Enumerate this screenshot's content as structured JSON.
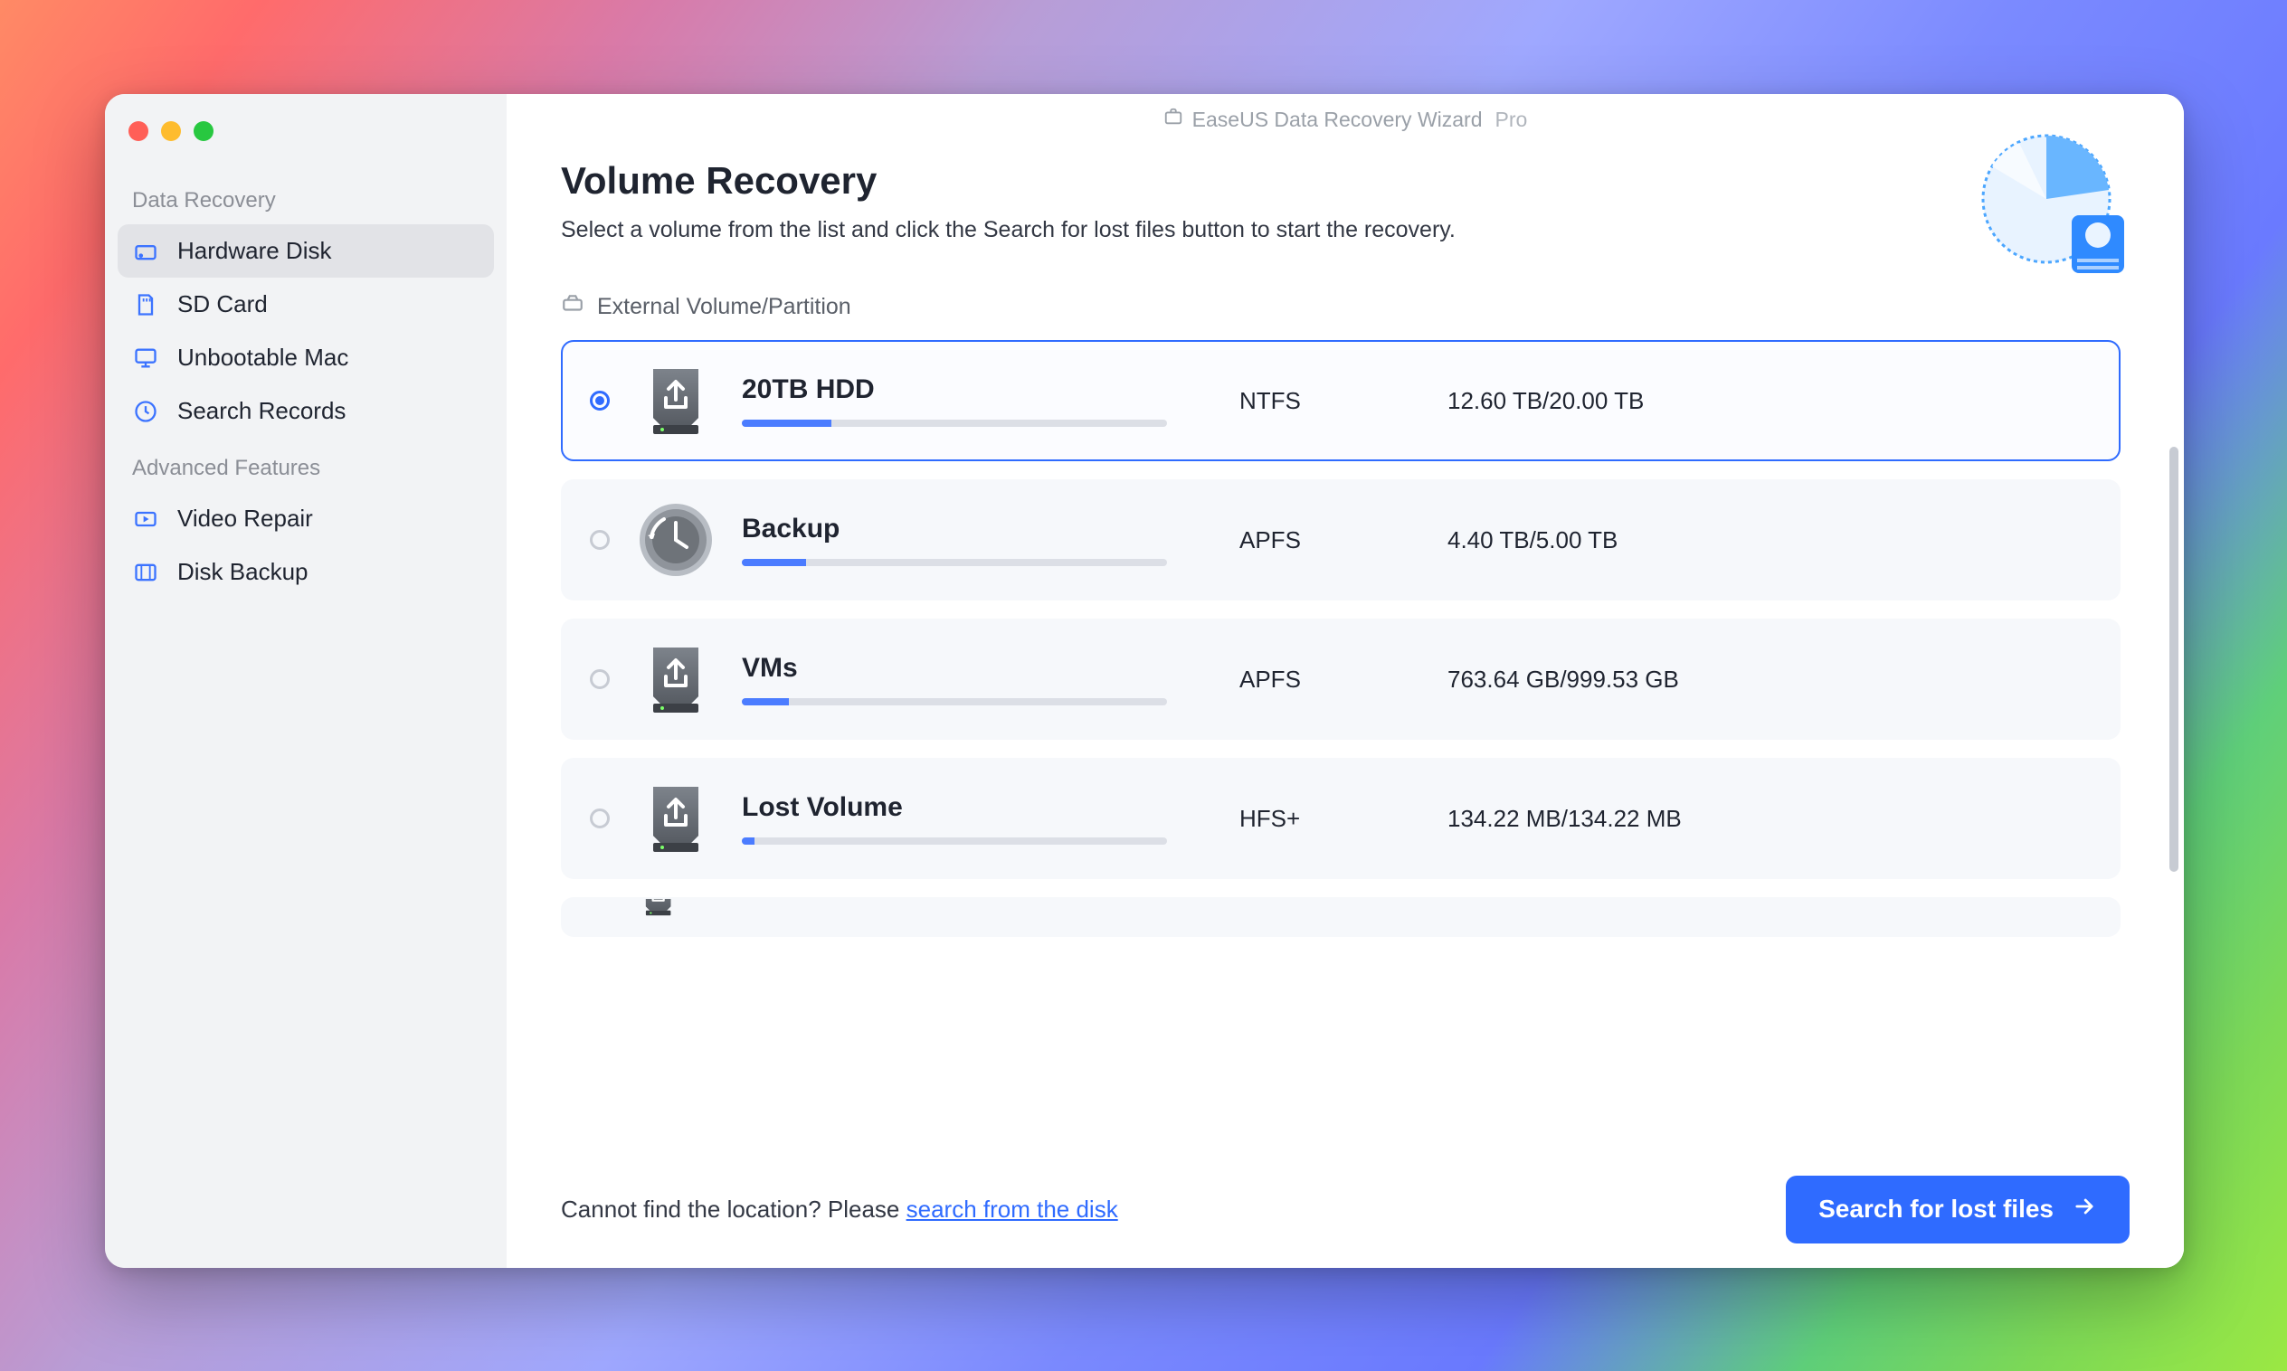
{
  "titlebar": {
    "app": "EaseUS Data Recovery Wizard",
    "edition": "Pro"
  },
  "sidebar": {
    "section1_label": "Data Recovery",
    "items1": [
      {
        "label": "Hardware Disk",
        "icon": "drive-icon",
        "active": true
      },
      {
        "label": "SD Card",
        "icon": "sd-card-icon",
        "active": false
      },
      {
        "label": "Unbootable Mac",
        "icon": "monitor-icon",
        "active": false
      },
      {
        "label": "Search Records",
        "icon": "clock-icon",
        "active": false
      }
    ],
    "section2_label": "Advanced Features",
    "items2": [
      {
        "label": "Video Repair",
        "icon": "video-icon"
      },
      {
        "label": "Disk Backup",
        "icon": "backup-icon"
      }
    ]
  },
  "main": {
    "heading": "Volume Recovery",
    "subheading": "Select a volume from the list and click the Search for lost files button to start the recovery.",
    "group_label": "External Volume/Partition"
  },
  "volumes": [
    {
      "name": "20TB HDD",
      "fs": "NTFS",
      "size": "12.60 TB/20.00 TB",
      "fill_pct": 21,
      "icon": "usb-drive",
      "selected": true
    },
    {
      "name": "Backup",
      "fs": "APFS",
      "size": "4.40 TB/5.00 TB",
      "fill_pct": 15,
      "icon": "time-machine",
      "selected": false
    },
    {
      "name": "VMs",
      "fs": "APFS",
      "size": "763.64 GB/999.53 GB",
      "fill_pct": 11,
      "icon": "usb-drive",
      "selected": false
    },
    {
      "name": "Lost Volume",
      "fs": "HFS+",
      "size": "134.22 MB/134.22 MB",
      "fill_pct": 3,
      "icon": "usb-drive",
      "selected": false
    }
  ],
  "footer": {
    "prefix": "Cannot find the location? Please ",
    "link": "search from the disk",
    "button": "Search for lost files"
  },
  "colors": {
    "accent": "#2f6bff"
  }
}
